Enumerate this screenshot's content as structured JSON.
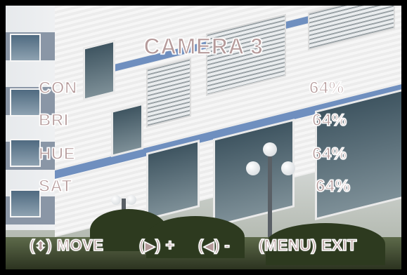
{
  "osd": {
    "title": "CAMERA 3",
    "settings": [
      {
        "label": "CON",
        "value": "64%"
      },
      {
        "label": "BRI",
        "value": "64%"
      },
      {
        "label": "HUE",
        "value": "64%"
      },
      {
        "label": "SAT",
        "value": "64%"
      }
    ],
    "help": {
      "move": {
        "open": "(",
        "glyph": "⬍",
        "close": ")",
        "text": " MOVE"
      },
      "plus": {
        "open": "(",
        "glyph": "▶",
        "close": ")",
        "text": " +"
      },
      "minus": {
        "open": "(",
        "glyph": "◀",
        "close": ")",
        "text": " -"
      },
      "exit": {
        "text": "(MENU) EXIT"
      }
    }
  },
  "colors": {
    "osd_fill": "#b59a9a",
    "osd_outline": "#ffffff",
    "border": "#000000"
  }
}
